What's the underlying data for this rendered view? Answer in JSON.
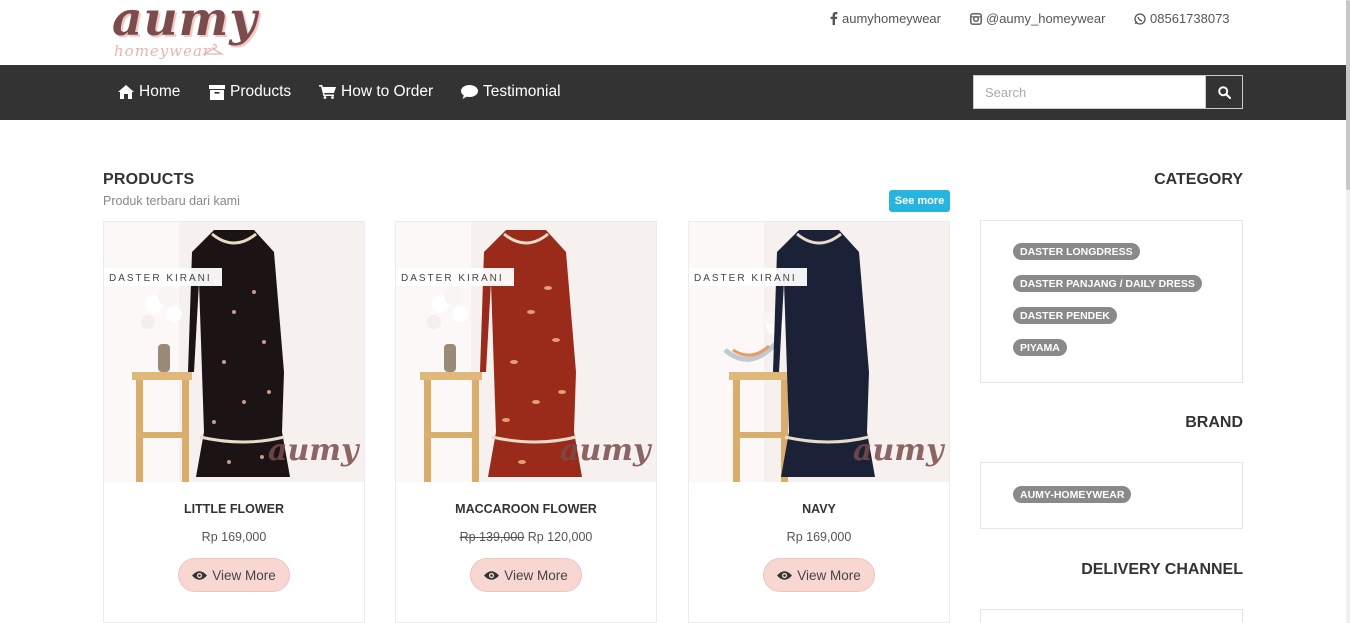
{
  "brand": {
    "logo_main": "aumy",
    "logo_sub": "homeywear"
  },
  "social": {
    "facebook": "aumyhomeywear",
    "instagram": "@aumy_homeywear",
    "whatsapp": "08561738073"
  },
  "nav": {
    "items": [
      {
        "label": "Home",
        "icon": "home-icon"
      },
      {
        "label": "Products",
        "icon": "archive-icon"
      },
      {
        "label": "How to Order",
        "icon": "cart-icon"
      },
      {
        "label": "Testimonial",
        "icon": "comment-icon"
      }
    ],
    "search_placeholder": "Search"
  },
  "products_section": {
    "title": "PRODUCTS",
    "subtitle": "Produk terbaru dari kami",
    "see_more": "See more",
    "image_label": "DASTER KIRANI",
    "image_watermark": "aumy",
    "items": [
      {
        "name": "LITTLE FLOWER",
        "price": "Rp 169,000",
        "old_price": "",
        "button": "View More",
        "dress_color": "#1c1414"
      },
      {
        "name": "MACCAROON FLOWER",
        "price": "Rp 120,000",
        "old_price": "Rp 139,000",
        "button": "View More",
        "dress_color": "#9a2a1a"
      },
      {
        "name": "NAVY",
        "price": "Rp 169,000",
        "old_price": "",
        "button": "View More",
        "dress_color": "#1b2238"
      }
    ]
  },
  "sidebar": {
    "category": {
      "title": "CATEGORY",
      "tags": [
        "DASTER LONGDRESS",
        "DASTER PANJANG / DAILY DRESS",
        "DASTER PENDEK",
        "PIYAMA"
      ]
    },
    "brand": {
      "title": "BRAND",
      "tags": [
        "AUMY-HOMEYWEAR"
      ]
    },
    "delivery": {
      "title": "DELIVERY CHANNEL"
    }
  },
  "colors": {
    "navbar": "#333333",
    "accent_button": "#27b5e0",
    "view_button": "#f8d7d3",
    "tag": "#8a8a8a"
  }
}
